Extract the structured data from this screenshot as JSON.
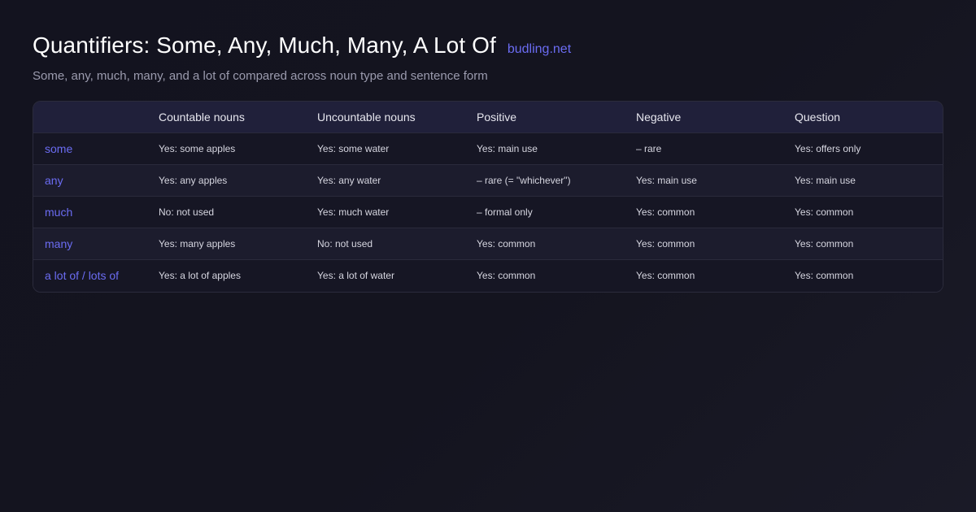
{
  "header": {
    "title": "Quantifiers: Some, Any, Much, Many, A Lot Of",
    "brand": "budling.net",
    "subtitle": "Some, any, much, many, and a lot of compared across noun type and sentence form"
  },
  "colors": {
    "accent": "#6b6cf2",
    "background": "#14141f",
    "header_row": "#20203a"
  },
  "table": {
    "columns": [
      "",
      "Countable nouns",
      "Uncountable nouns",
      "Positive",
      "Negative",
      "Question"
    ],
    "rows": [
      {
        "term": "some",
        "cells": [
          "Yes: some apples",
          "Yes: some water",
          "Yes: main use",
          "– rare",
          "Yes: offers only"
        ]
      },
      {
        "term": "any",
        "cells": [
          "Yes: any apples",
          "Yes: any water",
          "– rare (= \"whichever\")",
          "Yes: main use",
          "Yes: main use"
        ]
      },
      {
        "term": "much",
        "cells": [
          "No: not used",
          "Yes: much water",
          "– formal only",
          "Yes: common",
          "Yes: common"
        ]
      },
      {
        "term": "many",
        "cells": [
          "Yes: many apples",
          "No: not used",
          "Yes: common",
          "Yes: common",
          "Yes: common"
        ]
      },
      {
        "term": "a lot of / lots of",
        "cells": [
          "Yes: a lot of apples",
          "Yes: a lot of water",
          "Yes: common",
          "Yes: common",
          "Yes: common"
        ]
      }
    ]
  }
}
